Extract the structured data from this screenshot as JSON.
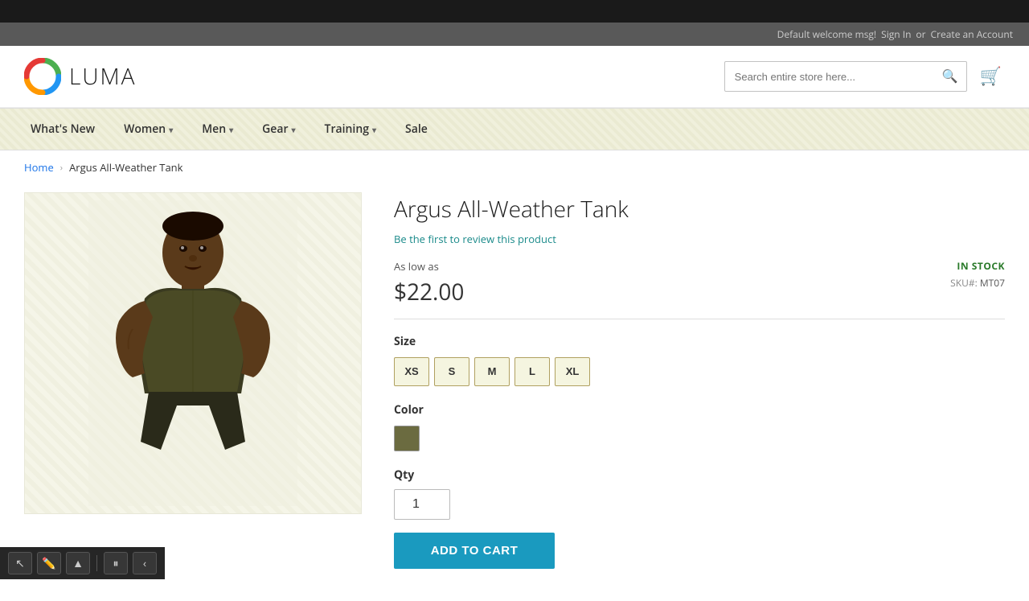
{
  "meta": {
    "page_title": "Argus All-Weather Tank - Luma"
  },
  "top_bar": {
    "welcome_msg": "Default welcome msg!",
    "sign_in": "Sign In",
    "or": "or",
    "create_account": "Create an Account"
  },
  "header": {
    "logo_text": "LUMA",
    "search_placeholder": "Search entire store here...",
    "search_icon": "search-icon",
    "cart_icon": "cart-icon"
  },
  "nav": {
    "items": [
      {
        "label": "What's New",
        "has_dropdown": false
      },
      {
        "label": "Women",
        "has_dropdown": true
      },
      {
        "label": "Men",
        "has_dropdown": true
      },
      {
        "label": "Gear",
        "has_dropdown": true
      },
      {
        "label": "Training",
        "has_dropdown": true
      },
      {
        "label": "Sale",
        "has_dropdown": false
      }
    ]
  },
  "breadcrumb": {
    "home": "Home",
    "separator": "›",
    "current": "Argus All-Weather Tank"
  },
  "product": {
    "title": "Argus All-Weather Tank",
    "review_link": "Be the first to review this product",
    "as_low_as": "As low as",
    "price": "$22.00",
    "stock_status": "IN STOCK",
    "sku_label": "SKU#:",
    "sku_value": "MT07",
    "size_label": "Size",
    "sizes": [
      "XS",
      "S",
      "M",
      "L",
      "XL"
    ],
    "color_label": "Color",
    "colors": [
      {
        "name": "Army Green",
        "hex": "#6b6b40"
      }
    ],
    "qty_label": "Qty",
    "qty_default": "1",
    "add_to_cart": "Add to Cart"
  },
  "toolbar": {
    "cursor_icon": "cursor-icon",
    "pen_icon": "pen-icon",
    "highlight_icon": "highlight-icon",
    "pause_icon": "pause-icon",
    "collapse_icon": "collapse-icon"
  }
}
